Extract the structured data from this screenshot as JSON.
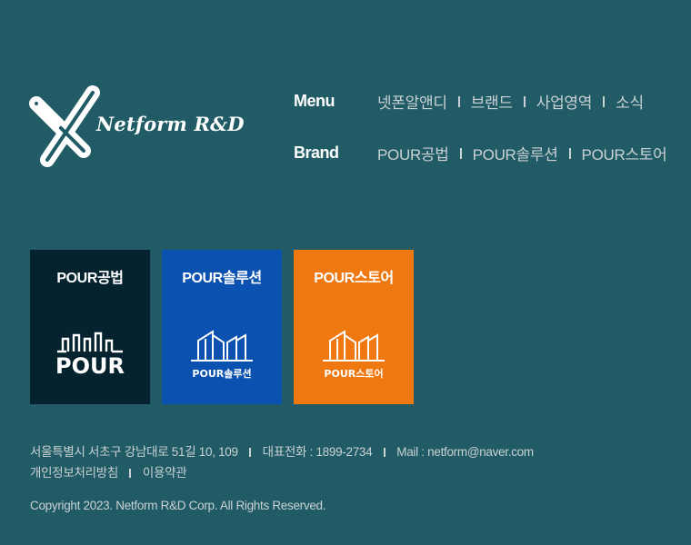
{
  "brand": {
    "logo_text": "Netform R&D"
  },
  "nav": {
    "menu": {
      "heading": "Menu",
      "items": [
        "넷폰알앤디",
        "브랜드",
        "사업영역",
        "소식"
      ]
    },
    "brand": {
      "heading": "Brand",
      "items": [
        "POUR공법",
        "POUR솔루션",
        "POUR스토어"
      ]
    }
  },
  "cards": [
    {
      "title": "POUR공법",
      "logo_text": "POUR",
      "color": "#05232f"
    },
    {
      "title": "POUR솔루션",
      "logo_text": "POUR솔루션",
      "color": "#0a51b0"
    },
    {
      "title": "POUR스토어",
      "logo_text": "POUR스토어",
      "color": "#ef7811"
    }
  ],
  "footer": {
    "address": "서울특별시 서초구 강남대로 51길 10, 109",
    "phone": "대표전화 : 1899-2734",
    "mail": "Mail : netform@naver.com",
    "privacy_link": "개인정보처리방침",
    "terms_link": "이용약관",
    "copyright": "Copyright 2023. Netform R&D Corp. All Rights Reserved."
  },
  "colors": {
    "background": "#215b66",
    "text_muted": "#c9d1d3"
  }
}
